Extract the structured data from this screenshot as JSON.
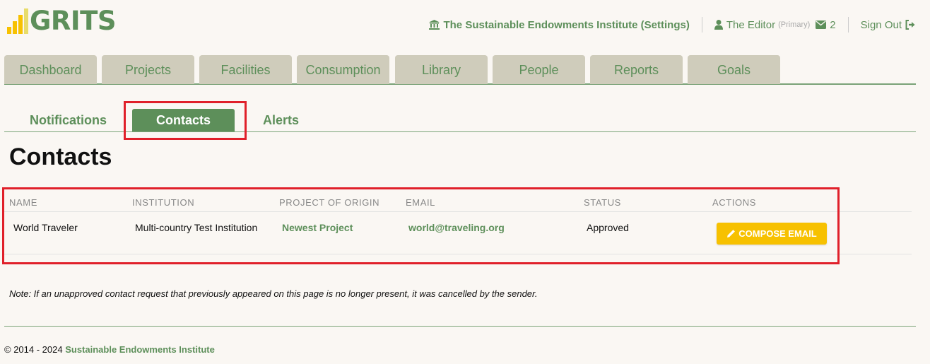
{
  "app": {
    "logo_text": "GRITS",
    "logo_bar_colors": [
      "#f7c100",
      "#f7c100",
      "#f7c100",
      "#e8dc6a"
    ]
  },
  "topnav": {
    "institution": "The Sustainable Endowments Institute (Settings)",
    "user": "The Editor",
    "user_role": "(Primary)",
    "mail_count": "2",
    "sign_out": "Sign Out"
  },
  "main_tabs": [
    {
      "label": "Dashboard"
    },
    {
      "label": "Projects"
    },
    {
      "label": "Facilities"
    },
    {
      "label": "Consumption"
    },
    {
      "label": "Library"
    },
    {
      "label": "People"
    },
    {
      "label": "Reports"
    },
    {
      "label": "Goals"
    }
  ],
  "sub_tabs": [
    {
      "label": "Notifications"
    },
    {
      "label": "Contacts"
    },
    {
      "label": "Alerts"
    }
  ],
  "page_title": "Contacts",
  "table": {
    "headers": [
      "NAME",
      "INSTITUTION",
      "PROJECT OF ORIGIN",
      "EMAIL",
      "STATUS",
      "ACTIONS"
    ],
    "rows": [
      {
        "name": "World Traveler",
        "institution": "Multi-country Test Institution",
        "project": "Newest Project",
        "email": "world@traveling.org",
        "status": "Approved",
        "action": "COMPOSE EMAIL"
      }
    ]
  },
  "note": "Note: If an unapproved contact request that previously appeared on this page is no longer present, it was cancelled by the sender.",
  "footer": {
    "copyright": "© 2014 - 2024",
    "link": "Sustainable Endowments Institute"
  },
  "colors": {
    "accent": "#5d8f5a",
    "tab_bg": "#cfccbb",
    "button": "#f7c100",
    "highlight": "#e0202a"
  }
}
